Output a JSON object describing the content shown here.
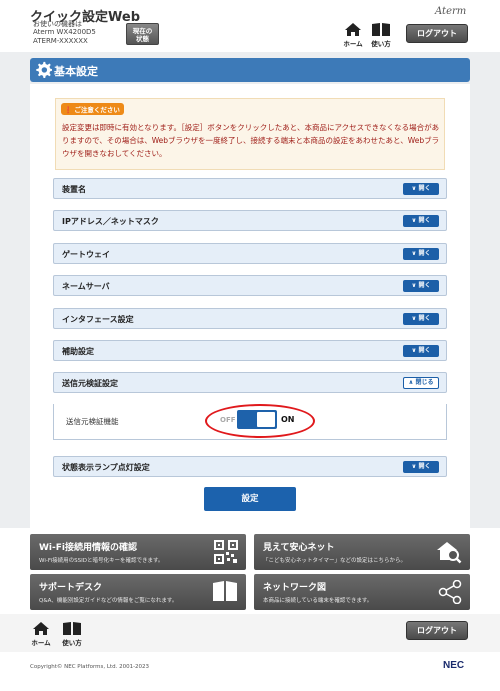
{
  "header": {
    "app_title": "クイック設定Web",
    "device_caption": "お使いの機器は",
    "device_model": "Aterm WX4200D5",
    "device_id": "ATERM-XXXXXX",
    "status_button": "現在の\n状態",
    "brand": "Aterm",
    "home_label": "ホーム",
    "help_label": "使い方",
    "logout_label": "ログアウト"
  },
  "section": {
    "title": "基本設定"
  },
  "notice": {
    "badge": "ご注意ください",
    "text": "設定変更は即時に有効となります。［設定］ボタンをクリックしたあと、本商品にアクセスできなくなる場合がありますので、その場合は、Webブラウザを一度終了し、接続する端末と本商品の設定をあわせたあと、Webブラウザを開きなおしてください。"
  },
  "accordions": [
    {
      "label": "装置名",
      "button": "開く"
    },
    {
      "label": "IPアドレス／ネットマスク",
      "button": "開く"
    },
    {
      "label": "ゲートウェイ",
      "button": "開く"
    },
    {
      "label": "ネームサーバ",
      "button": "開く"
    },
    {
      "label": "インタフェース設定",
      "button": "開く"
    },
    {
      "label": "補助設定",
      "button": "開く"
    },
    {
      "label": "送信元検証設定",
      "button": "閉じる"
    },
    {
      "label": "状態表示ランプ点灯設定",
      "button": "開く"
    }
  ],
  "source_verify": {
    "row_label": "送信元検証機能",
    "off_label": "OFF",
    "on_label": "ON",
    "state": "ON"
  },
  "submit_label": "設定",
  "tiles": [
    {
      "title": "Wi-Fi接続用情報の確認",
      "desc": "Wi-Fi接続用のSSIDと暗号化キーを確認できます。"
    },
    {
      "title": "見えて安心ネット",
      "desc": "「こども安心ネットタイマー」などの設定はこちらから。"
    },
    {
      "title": "サポートデスク",
      "desc": "Q&A、機能別設定ガイドなどの情報をご覧になれます。"
    },
    {
      "title": "ネットワーク図",
      "desc": "本商品に接続している端末を確認できます。"
    }
  ],
  "footer": {
    "home_label": "ホーム",
    "help_label": "使い方",
    "logout_label": "ログアウト",
    "copyright": "Copyright© NEC Platforms, Ltd. 2001-2023",
    "logo": "NEC"
  },
  "colors": {
    "accent": "#1c62ad",
    "header_bar": "#3d7ab8",
    "notice_text": "#a0201a",
    "highlight": "#e0191c"
  }
}
